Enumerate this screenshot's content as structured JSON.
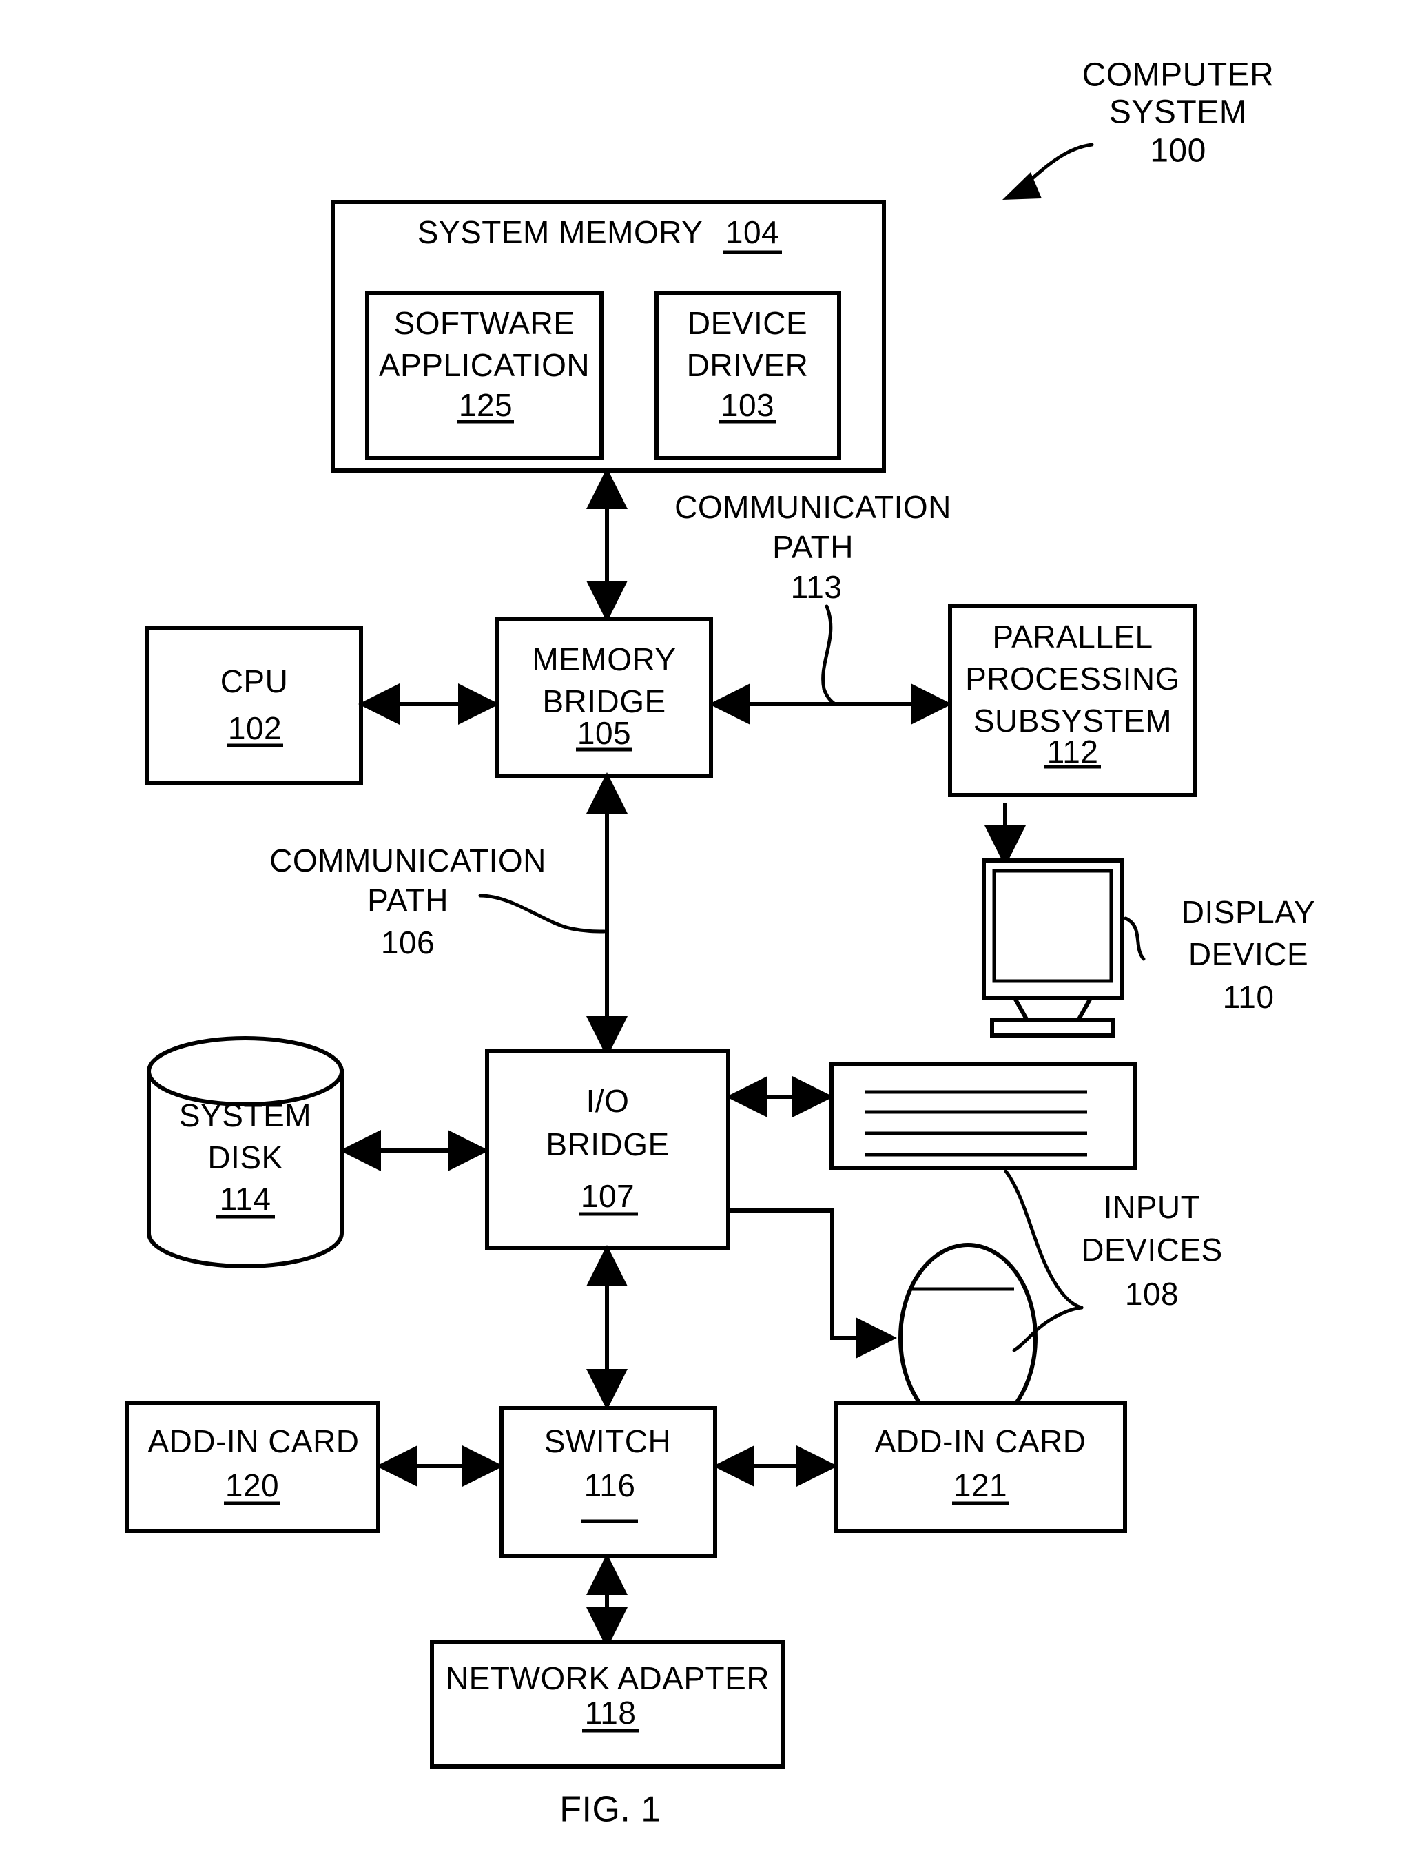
{
  "figure": {
    "caption": "FIG. 1",
    "annotation": {
      "line1": "COMPUTER",
      "line2": "SYSTEM",
      "ref": "100"
    }
  },
  "blocks": {
    "system_memory": {
      "title": "SYSTEM MEMORY",
      "ref": "104"
    },
    "software_application": {
      "line1": "SOFTWARE",
      "line2": "APPLICATION",
      "ref": "125"
    },
    "device_driver": {
      "line1": "DEVICE",
      "line2": "DRIVER",
      "ref": "103"
    },
    "cpu": {
      "line1": "CPU",
      "ref": "102"
    },
    "memory_bridge": {
      "line1": "MEMORY",
      "line2": "BRIDGE",
      "ref": "105"
    },
    "parallel_processing_subsystem": {
      "line1": "PARALLEL",
      "line2": "PROCESSING",
      "line3": "SUBSYSTEM",
      "ref": "112"
    },
    "display_device": {
      "line1": "DISPLAY",
      "line2": "DEVICE",
      "ref": "110"
    },
    "system_disk": {
      "line1": "SYSTEM",
      "line2": "DISK",
      "ref": "114"
    },
    "io_bridge": {
      "line1": "I/O",
      "line2": "BRIDGE",
      "ref": "107"
    },
    "input_devices": {
      "line1": "INPUT",
      "line2": "DEVICES",
      "ref": "108"
    },
    "add_in_card_120": {
      "line1": "ADD-IN CARD",
      "ref": "120"
    },
    "switch": {
      "line1": "SWITCH",
      "ref": "116"
    },
    "add_in_card_121": {
      "line1": "ADD-IN CARD",
      "ref": "121"
    },
    "network_adapter": {
      "line1": "NETWORK ADAPTER",
      "ref": "118"
    }
  },
  "paths": {
    "comm_path_113": {
      "line1": "COMMUNICATION",
      "line2": "PATH",
      "ref": "113"
    },
    "comm_path_106": {
      "line1": "COMMUNICATION",
      "line2": "PATH",
      "ref": "106"
    }
  },
  "colors": {
    "ink": "#000000",
    "paper": "#ffffff"
  }
}
